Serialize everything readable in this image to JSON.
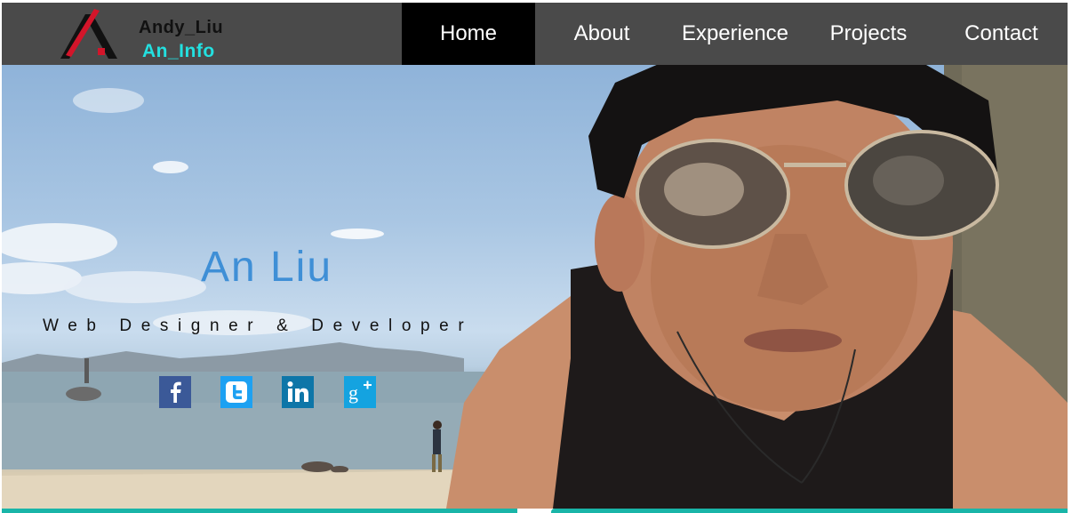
{
  "brand": {
    "name": "Andy_Liu",
    "subtitle": "An_Info",
    "logo_icon": "red-black-A-logo"
  },
  "nav": {
    "items": [
      {
        "label": "Home",
        "active": true
      },
      {
        "label": "About",
        "active": false
      },
      {
        "label": "Experience",
        "active": false
      },
      {
        "label": "Projects",
        "active": false
      },
      {
        "label": "Contact",
        "active": false
      }
    ]
  },
  "hero": {
    "name": "An Liu",
    "title": "Web Designer & Developer",
    "background_photo": "selfie-at-beach-with-aviator-sunglasses"
  },
  "social": [
    {
      "icon": "facebook-icon",
      "glyph": "f",
      "color": "#3b5998"
    },
    {
      "icon": "twitter-icon",
      "glyph": "t",
      "color": "#1da1f2"
    },
    {
      "icon": "linkedin-icon",
      "glyph": "in",
      "color": "#0e76a8"
    },
    {
      "icon": "google-plus-icon",
      "glyph": "g+",
      "color": "#14a3e0"
    }
  ],
  "colors": {
    "nav_bg": "#4a4a4a",
    "nav_active_bg": "#000000",
    "accent_cyan": "#23e0e0",
    "name_blue": "#3f8fd6",
    "bottom_bar": "#19b5a8"
  }
}
